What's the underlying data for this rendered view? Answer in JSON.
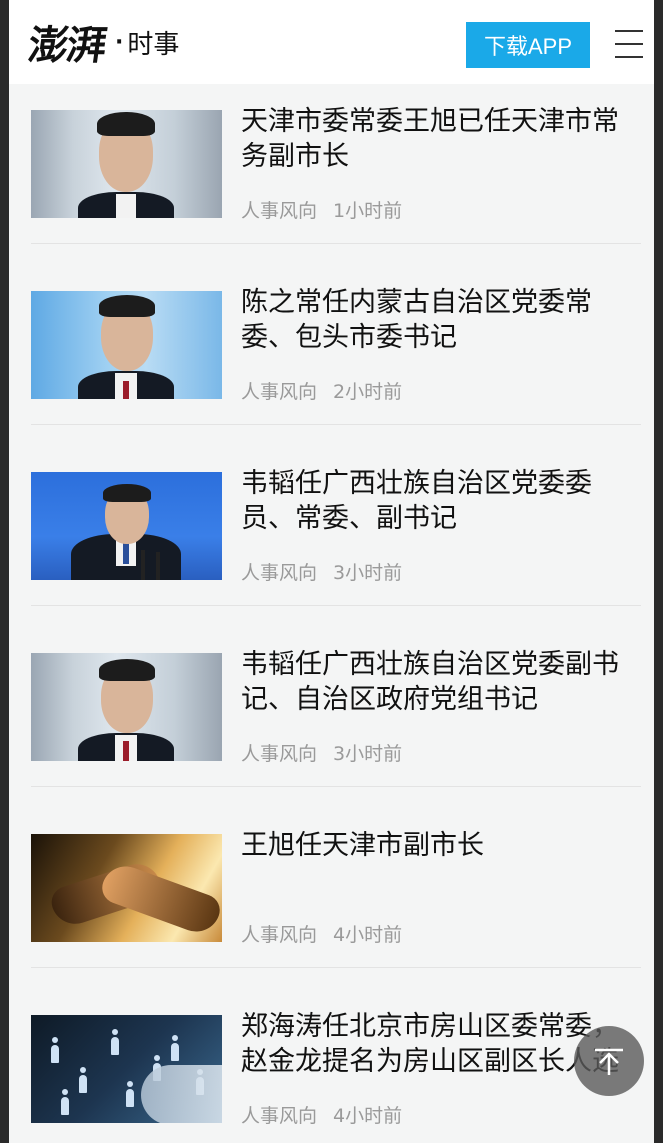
{
  "header": {
    "logo_mark": "澎湃",
    "logo_dot": "·",
    "section": "时事",
    "download_label": "下载APP",
    "menu_icon": "hamburger-menu-icon"
  },
  "articles": [
    {
      "title": "天津市委常委王旭已任天津市常务副市长",
      "category": "人事风向",
      "time": "1小时前",
      "thumb": "portrait-grey"
    },
    {
      "title": "陈之常任内蒙古自治区党委常委、包头市委书记",
      "category": "人事风向",
      "time": "2小时前",
      "thumb": "portrait-sky"
    },
    {
      "title": "韦韬任广西壮族自治区党委委员、常委、副书记",
      "category": "人事风向",
      "time": "3小时前",
      "thumb": "press-conference-blue"
    },
    {
      "title": "韦韬任广西壮族自治区党委副书记、自治区政府党组书记",
      "category": "人事风向",
      "time": "3小时前",
      "thumb": "portrait-grey"
    },
    {
      "title": "王旭任天津市副市长",
      "category": "人事风向",
      "time": "4小时前",
      "thumb": "handshake"
    },
    {
      "title": "郑海涛任北京市房山区委常委，赵金龙提名为房山区副区长人选",
      "category": "人事风向",
      "time": "4小时前",
      "thumb": "network-people"
    }
  ],
  "back_to_top_icon": "arrow-up-icon"
}
